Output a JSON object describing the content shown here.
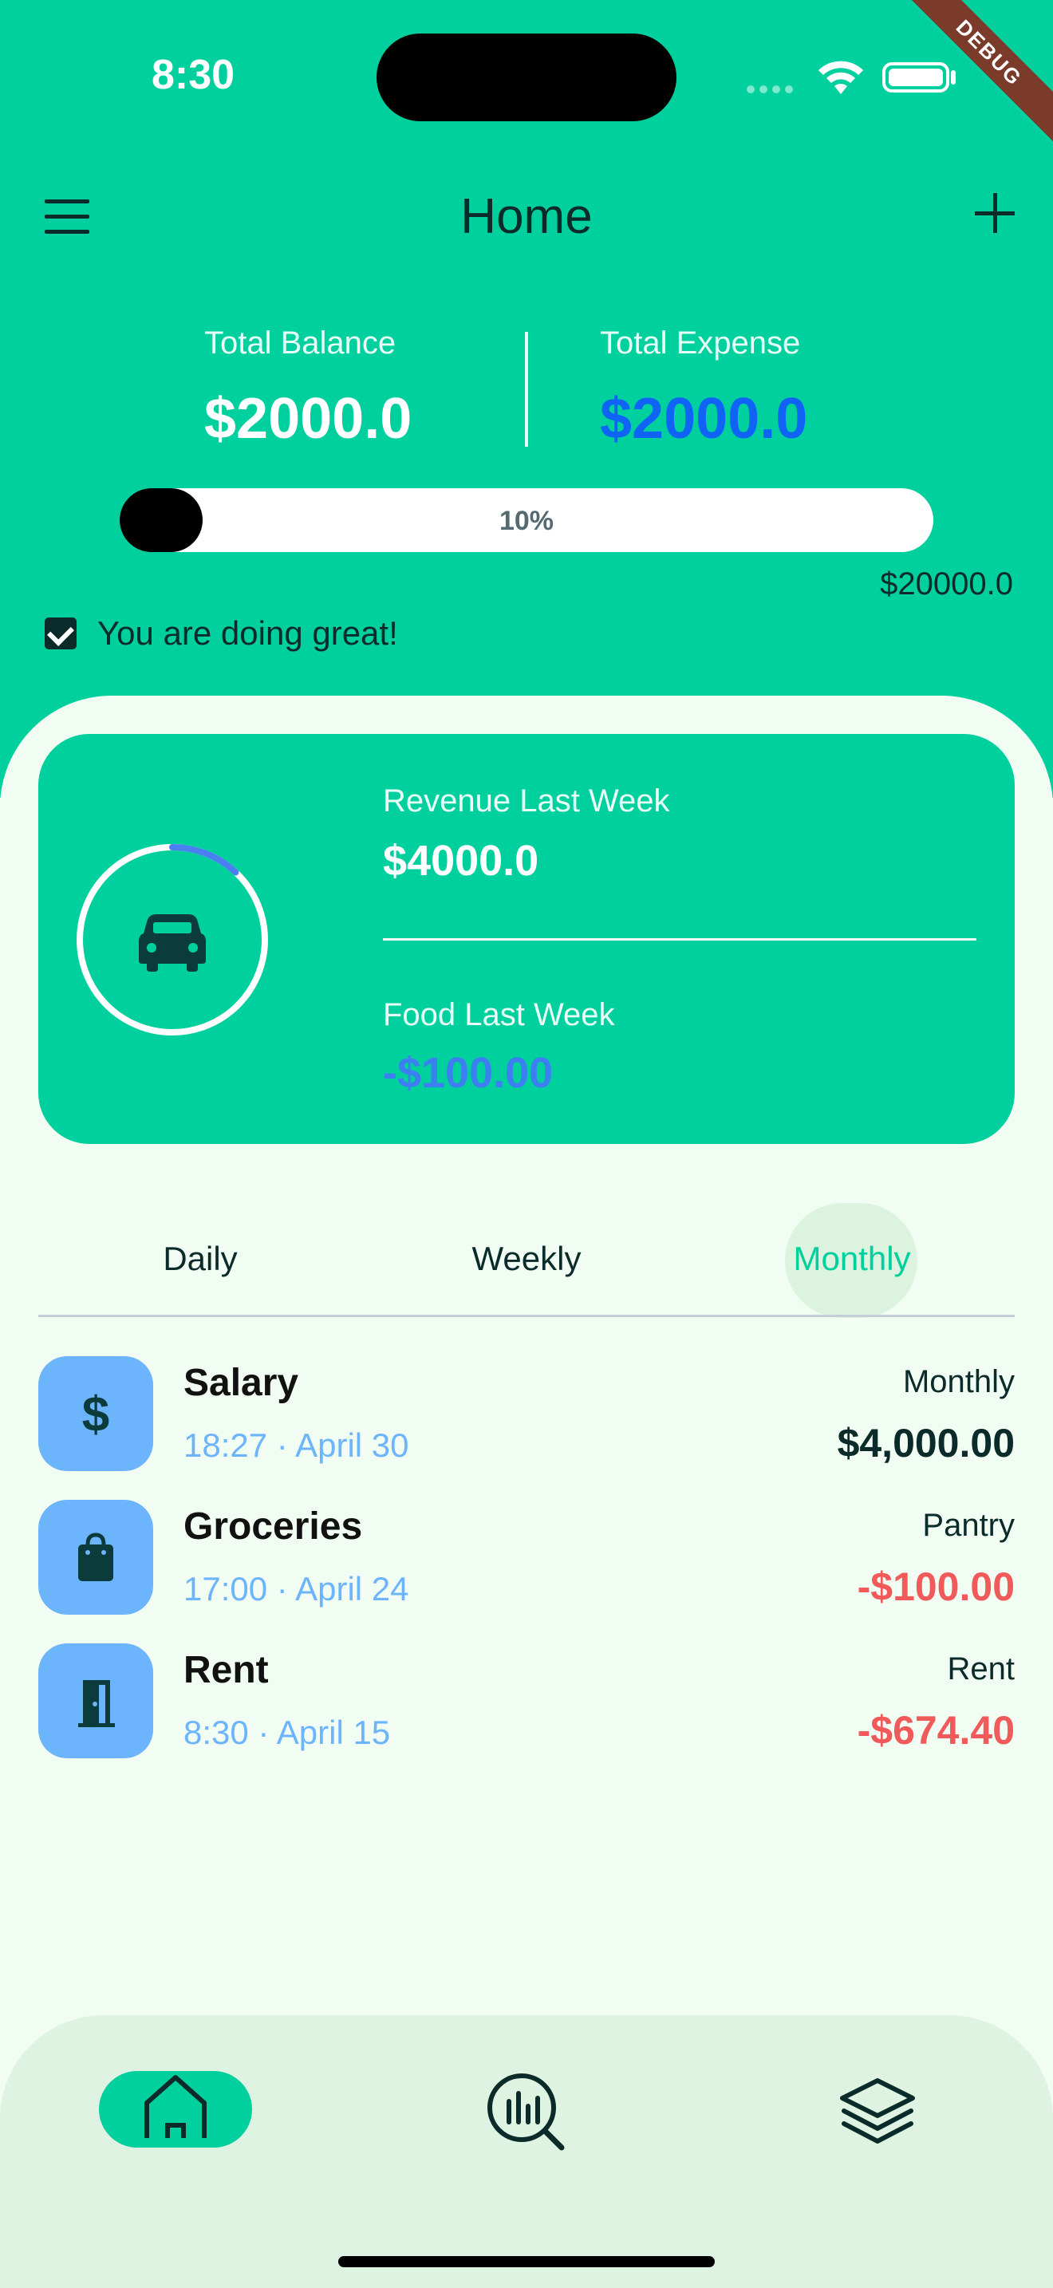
{
  "status_bar": {
    "time": "8:30"
  },
  "debug_banner": "DEBUG",
  "app_bar": {
    "title": "Home"
  },
  "summary": {
    "balance_label": "Total Balance",
    "balance_value": "$2000.0",
    "expense_label": "Total Expense",
    "expense_value": "$2000.0",
    "progress_percent_text": "10%",
    "progress_fraction": 0.1,
    "goal_amount": "$20000.0",
    "status_text": "You are doing great!",
    "status_checked": true
  },
  "card": {
    "revenue_label": "Revenue Last Week",
    "revenue_value": "$4000.0",
    "food_label": "Food Last Week",
    "food_value": "-$100.00",
    "ring_progress_fraction": 0.12,
    "icon": "car-icon"
  },
  "tabs": [
    {
      "label": "Daily",
      "selected": false
    },
    {
      "label": "Weekly",
      "selected": false
    },
    {
      "label": "Monthly",
      "selected": true
    }
  ],
  "transactions": [
    {
      "title": "Salary",
      "subtitle": "18:27 · April 30",
      "category": "Monthly",
      "amount": "$4,000.00",
      "icon": "dollar-icon",
      "amount_color": "#0b2a2a"
    },
    {
      "title": "Groceries",
      "subtitle": "17:00 · April 24",
      "category": "Pantry",
      "amount": "-$100.00",
      "icon": "shopping-bag-icon",
      "amount_color": "#f05a5a"
    },
    {
      "title": "Rent",
      "subtitle": "8:30 · April 15",
      "category": "Rent",
      "amount": "-$674.40",
      "icon": "door-icon",
      "amount_color": "#f05a5a"
    }
  ],
  "bottom_nav": [
    {
      "icon": "home-icon",
      "selected": true
    },
    {
      "icon": "analysis-icon",
      "selected": false
    },
    {
      "icon": "layers-icon",
      "selected": false
    }
  ],
  "colors": {
    "primary": "#00d09e",
    "dark": "#0b2a2a",
    "expense_blue": "#0f64f5",
    "food_blue": "#3d7ff2",
    "icon_tile": "#6cb5fd",
    "negative": "#f05a5a",
    "ring_accent": "#4a7ff0"
  }
}
